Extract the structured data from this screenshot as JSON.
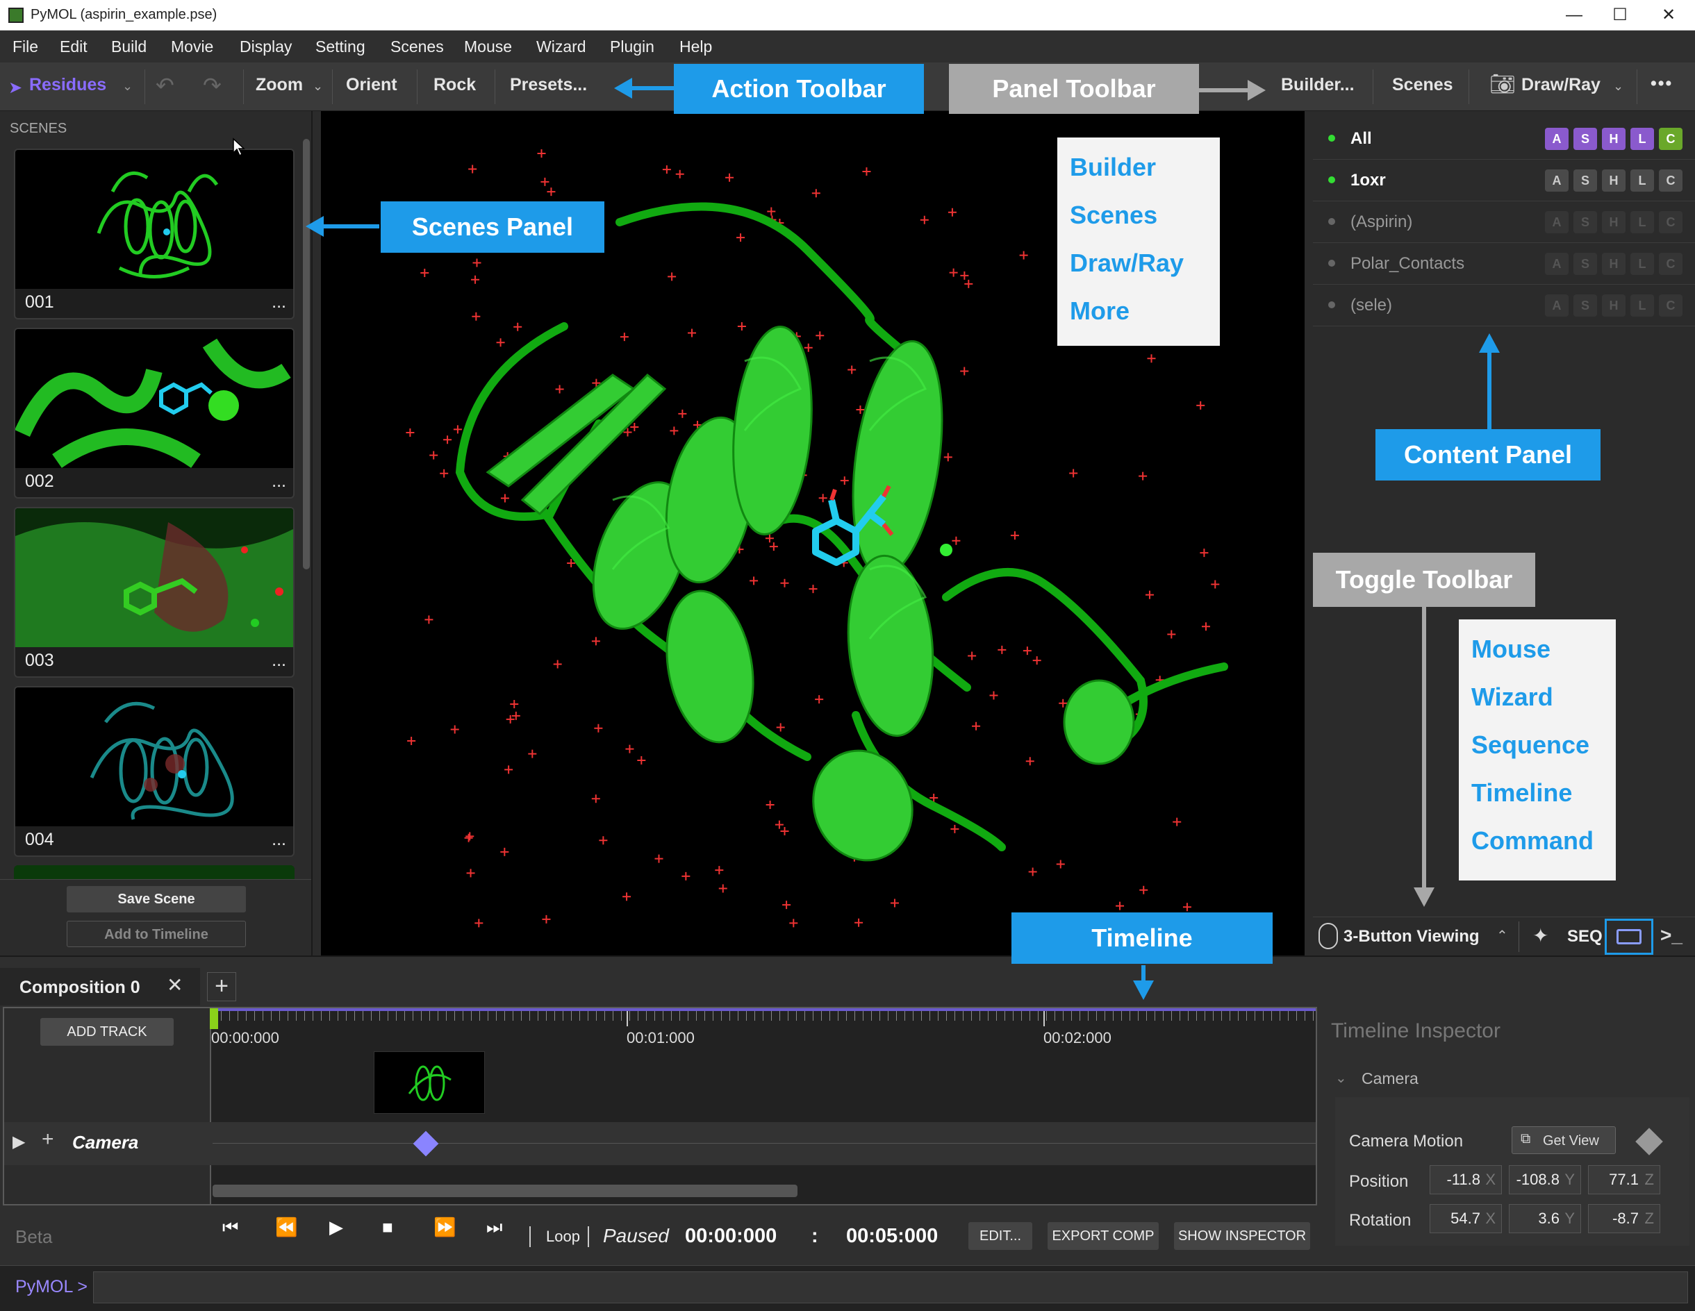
{
  "window": {
    "title": "PyMOL (aspirin_example.pse)",
    "minimize": "—",
    "maximize": "☐",
    "close": "✕"
  },
  "menu": [
    "File",
    "Edit",
    "Build",
    "Movie",
    "Display",
    "Setting",
    "Scenes",
    "Mouse",
    "Wizard",
    "Plugin",
    "Help"
  ],
  "toolbar": {
    "selection_mode": "Residues",
    "zoom": "Zoom",
    "orient": "Orient",
    "rock": "Rock",
    "presets": "Presets...",
    "builder": "Builder...",
    "scenes": "Scenes",
    "draw_ray": "Draw/Ray",
    "more": "•••"
  },
  "scenes_panel": {
    "header": "SCENES",
    "scenes": [
      {
        "name": "001",
        "menu": "..."
      },
      {
        "name": "002",
        "menu": "..."
      },
      {
        "name": "003",
        "menu": "..."
      },
      {
        "name": "004",
        "menu": "..."
      }
    ],
    "save_scene": "Save Scene",
    "add_to_timeline": "Add to Timeline"
  },
  "objects": [
    {
      "name": "All",
      "enabled": true,
      "buttons": [
        "A",
        "S",
        "H",
        "L",
        "C"
      ],
      "colored": true
    },
    {
      "name": "1oxr",
      "enabled": true,
      "buttons": [
        "A",
        "S",
        "H",
        "L",
        "C"
      ],
      "colored": false
    },
    {
      "name": "(Aspirin)",
      "enabled": false,
      "buttons": [
        "A",
        "S",
        "H",
        "L",
        "C"
      ],
      "colored": false
    },
    {
      "name": "Polar_Contacts",
      "enabled": false,
      "buttons": [
        "A",
        "S",
        "H",
        "L",
        "C"
      ],
      "colored": false
    },
    {
      "name": "(sele)",
      "enabled": false,
      "buttons": [
        "A",
        "S",
        "H",
        "L",
        "C"
      ],
      "colored": false
    }
  ],
  "toggle_toolbar": {
    "mouse_mode": "3-Button Viewing",
    "seq": "SEQ",
    "command_glyph": ">_"
  },
  "timeline": {
    "tab": "Composition 0",
    "add_track": "ADD TRACK",
    "ticks": [
      "00:00:000",
      "00:01:000",
      "00:02:000"
    ],
    "track": "Camera",
    "playhead_progress": 0.0
  },
  "inspector": {
    "title": "Timeline Inspector",
    "section": "Camera",
    "camera_motion": "Camera Motion",
    "get_view": "Get View",
    "position_label": "Position",
    "position": [
      "-11.8",
      "-108.8",
      "77.1"
    ],
    "rotation_label": "Rotation",
    "rotation": [
      "54.7",
      "3.6",
      "-8.7"
    ],
    "axes": [
      "X",
      "Y",
      "Z"
    ]
  },
  "playback": {
    "beta": "Beta",
    "loop": "Loop",
    "status": "Paused",
    "current_time": "00:00:000",
    "separator": ":",
    "end_time": "00:05:000",
    "edit": "EDIT...",
    "export": "EXPORT COMP",
    "inspector": "SHOW INSPECTOR"
  },
  "command": {
    "prompt": "PyMOL >"
  },
  "annotations": {
    "action_toolbar": "Action Toolbar",
    "panel_toolbar": "Panel Toolbar",
    "scenes_panel": "Scenes Panel",
    "content_panel": "Content Panel",
    "toggle_toolbar": "Toggle Toolbar",
    "timeline": "Timeline",
    "panel_list": [
      "Builder",
      "Scenes",
      "Draw/Ray",
      "More"
    ],
    "toggle_list": [
      "Mouse",
      "Wizard",
      "Sequence",
      "Timeline",
      "Command"
    ]
  },
  "colors": {
    "accent_purple": "#8a6cff",
    "protein_green": "#22cc22",
    "ligand_cyan": "#22ccee",
    "annotation_blue": "#1e9be9",
    "annotation_gray": "#a8a8a8"
  }
}
